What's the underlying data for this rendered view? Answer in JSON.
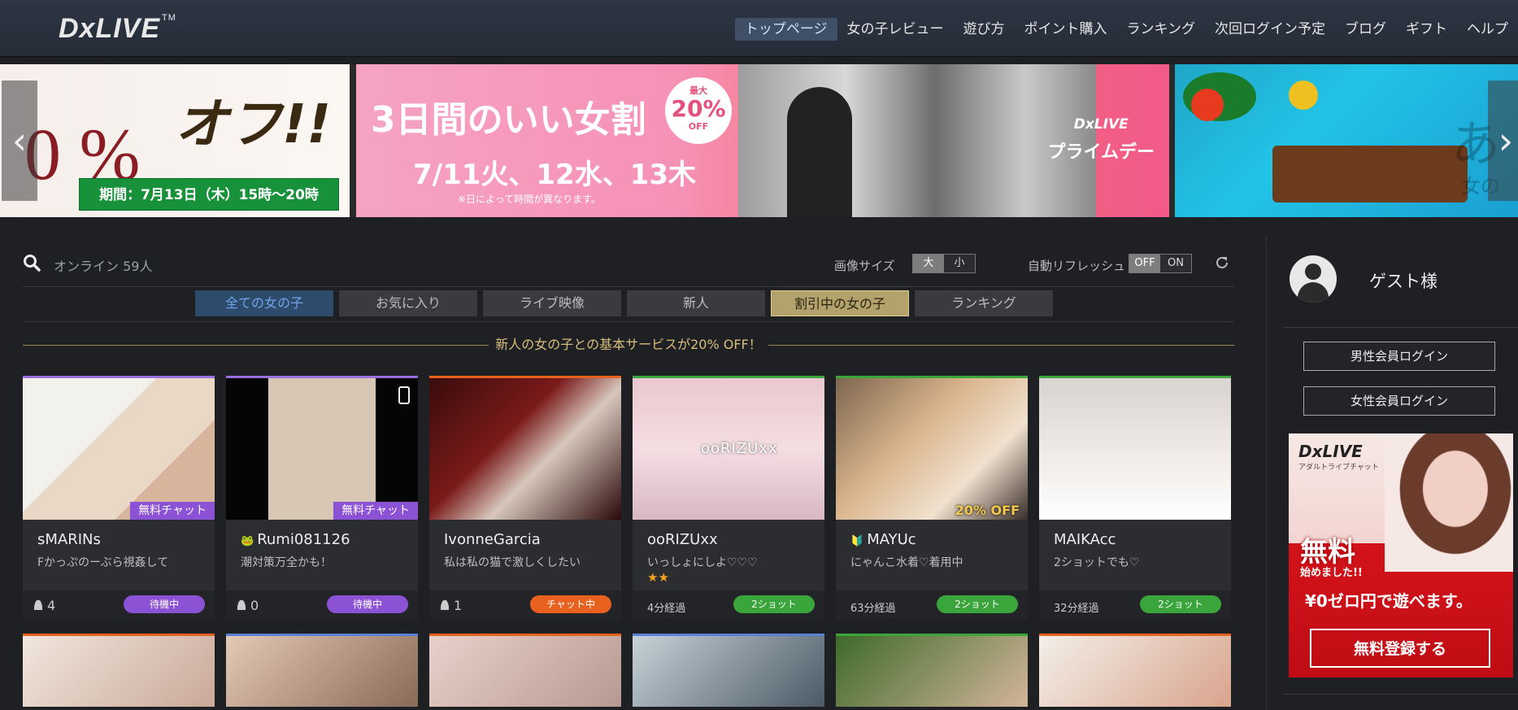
{
  "brand": {
    "logo": "DxLIVE",
    "tm": "TM"
  },
  "nav": [
    {
      "label": "トップページ",
      "active": true
    },
    {
      "label": "女の子レビュー"
    },
    {
      "label": "遊び方"
    },
    {
      "label": "ポイント購入"
    },
    {
      "label": "ランキング"
    },
    {
      "label": "次回ログイン予定"
    },
    {
      "label": "ブログ"
    },
    {
      "label": "ギフト"
    },
    {
      "label": "ヘルプ"
    }
  ],
  "banners": {
    "left": {
      "percent": "0 %",
      "off": "オフ!!",
      "period": "期間：7月13日（木）15時～20時"
    },
    "center": {
      "headline": "3日間のいい女割",
      "badge_small": "最大",
      "badge_percent": "20%",
      "badge_off": "OFF",
      "dates": "7/11火、12水、13木",
      "note": "※日によって時間が異なります。",
      "brand": "DxLIVE",
      "event": "プライムデー"
    },
    "right": {
      "text": "あ",
      "subtext": "女の"
    },
    "arrow_left": "‹",
    "arrow_right": "›"
  },
  "toolbar": {
    "online_label": "オンライン 59人",
    "image_size_label": "画像サイズ",
    "size_large": "大",
    "size_small": "小",
    "auto_refresh_label": "自動リフレッシュ",
    "refresh_off": "OFF",
    "refresh_on": "ON"
  },
  "tabs": [
    {
      "label": "全ての女の子",
      "state": "active"
    },
    {
      "label": "お気に入り"
    },
    {
      "label": "ライブ映像"
    },
    {
      "label": "新人"
    },
    {
      "label": "割引中の女の子",
      "state": "discount"
    },
    {
      "label": "ランキング"
    }
  ],
  "promo": "新人の女の子との基本サービスが20% OFF！",
  "cards": [
    {
      "name": "sMARINs",
      "desc": "Fかっぷのーぶら視姦して",
      "tag": "無料チャット",
      "viewers": "4",
      "status": "待機中",
      "status_type": "wait",
      "border": "#9a6fe0"
    },
    {
      "name": "Rumi081126",
      "desc": "潮対策万全かも！",
      "tag": "無料チャット",
      "viewers": "0",
      "status": "待機中",
      "status_type": "wait",
      "border": "#9a6fe0",
      "prefix": "🐸",
      "phone": true
    },
    {
      "name": "IvonneGarcia",
      "desc": "私は私の猫で激しくしたい",
      "viewers": "1",
      "status": "チャット中",
      "status_type": "chat",
      "border": "#e8611f"
    },
    {
      "name": "ooRIZUxx",
      "desc": "いっしょにしよ♡♡♡",
      "stars": "★★",
      "elapsed": "4分経過",
      "status": "2ショット",
      "status_type": "two",
      "border": "#3aa53a",
      "overlay": "ooRIZUxx"
    },
    {
      "name": "MAYUc",
      "desc": "にゃんこ水着♡着用中",
      "tag": "20% OFF",
      "tag_type": "off",
      "elapsed": "63分経過",
      "status": "2ショット",
      "status_type": "two",
      "border": "#3aa53a",
      "prefix": "🔰"
    },
    {
      "name": "MAIKAcc",
      "desc": "2ショットでも♡",
      "elapsed": "32分経過",
      "status": "2ショット",
      "status_type": "two",
      "border": "#3aa53a"
    }
  ],
  "sidebar": {
    "guest_label": "ゲスト様",
    "male_login": "男性会員ログイン",
    "female_login": "女性会員ログイン",
    "ad": {
      "brand": "DxLIVE",
      "sub": "アダルトライブチャット",
      "free": "無料",
      "free2": "始めました!!",
      "zero": "¥0ゼロ円で遊べます。",
      "cta": "無料登録する"
    }
  }
}
